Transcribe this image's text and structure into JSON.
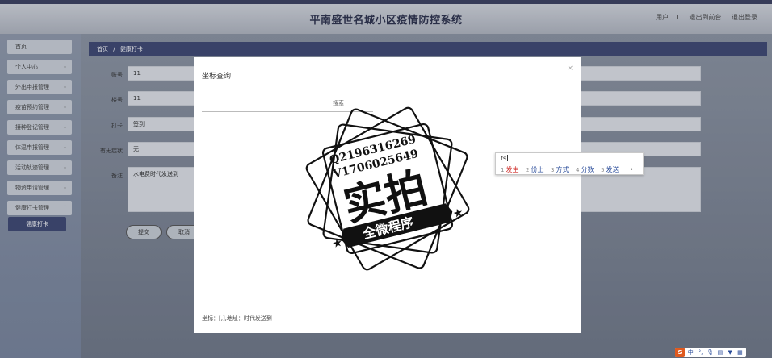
{
  "header": {
    "title": "平南盛世名城小区疫情防控系统",
    "user": "用户 11",
    "back_front": "退出到前台",
    "logout": "退出登录"
  },
  "sidebar": {
    "items": [
      {
        "label": "首页"
      },
      {
        "label": "个人中心"
      },
      {
        "label": "外出申报管理"
      },
      {
        "label": "疫苗预约管理"
      },
      {
        "label": "接种登记管理"
      },
      {
        "label": "体温申报管理"
      },
      {
        "label": "活动轨迹管理"
      },
      {
        "label": "物资申请管理"
      },
      {
        "label": "健康打卡管理"
      }
    ],
    "active_sub": "健康打卡"
  },
  "breadcrumb": {
    "home": "首页",
    "sep": "/",
    "current": "健康打卡"
  },
  "form": {
    "account_label": "账号",
    "account_value": "11",
    "building_label": "楼号",
    "building_value": "11",
    "checkin_label": "打卡",
    "checkin_value": "签到",
    "symptom_label": "有无症状",
    "symptom_value": "无",
    "note_label": "备注",
    "note_value": "水电费时代发送到",
    "submit": "提交",
    "cancel": "取消"
  },
  "modal": {
    "title": "坐标查询",
    "close": "×",
    "search_button": "搜索",
    "footer": "坐标：[,],地址：时代发送到"
  },
  "stamp": {
    "line1": "Q2196316269",
    "line2": "V1706025649",
    "big": "实拍",
    "ribbon": "全微程序"
  },
  "ime": {
    "composition": "fs",
    "candidates": [
      {
        "n": "1",
        "w": "发生"
      },
      {
        "n": "2",
        "w": "份上"
      },
      {
        "n": "3",
        "w": "方式"
      },
      {
        "n": "4",
        "w": "分数"
      },
      {
        "n": "5",
        "w": "发送"
      }
    ],
    "next": "›"
  },
  "imebar": {
    "logo": "S",
    "lang": "中"
  },
  "colors": {
    "accent": "#3d4670",
    "ime_first": "#d0302d",
    "ime_link": "#2a4c9a"
  }
}
